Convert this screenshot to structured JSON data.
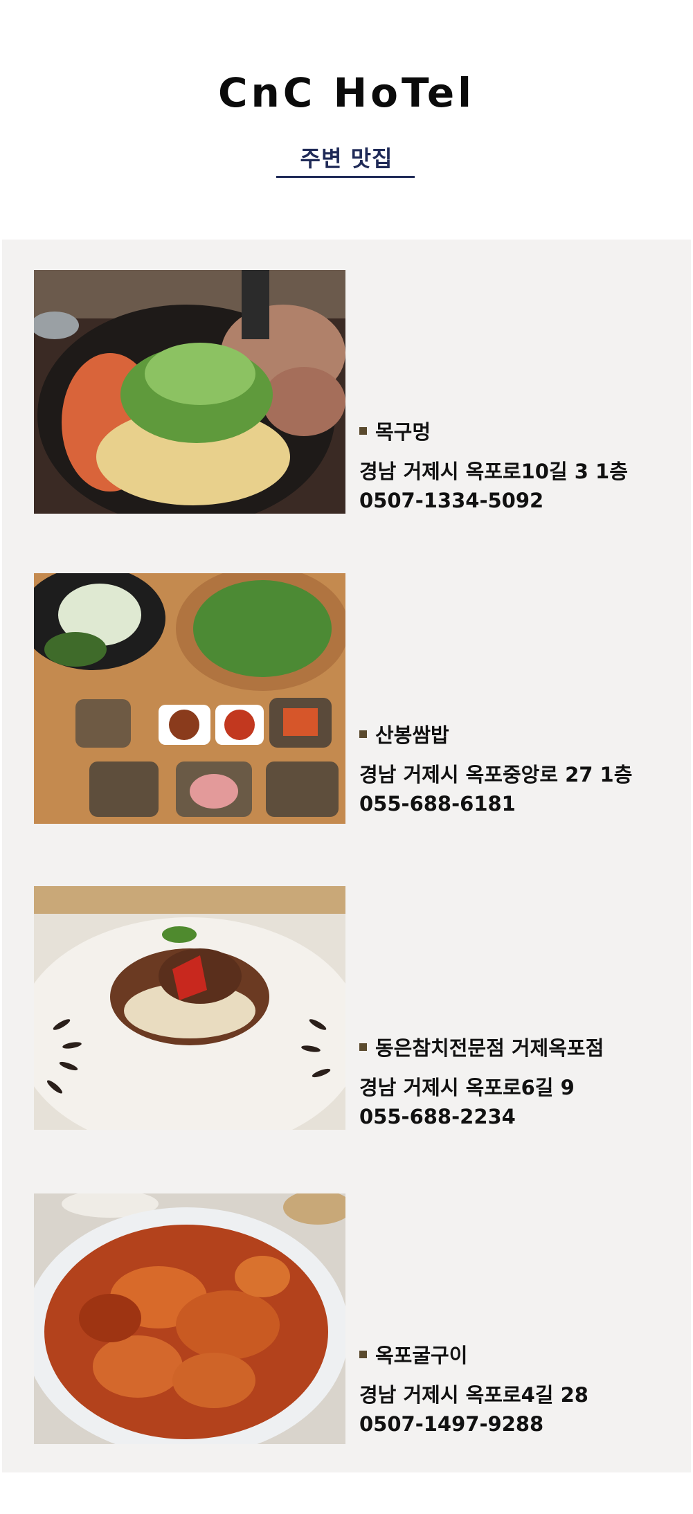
{
  "header": {
    "brand": "CnC HoTel",
    "subtitle": "주변 맛집",
    "accent_color": "#1f2a57"
  },
  "restaurants": [
    {
      "name": "목구멍",
      "address": "경남 거제시 옥포로10길 3 1층",
      "phone": "0507-1334-5092",
      "photo": "samgyeopsal-with-bean-sprouts-photo"
    },
    {
      "name": "산봉쌈밥",
      "address": "경남 거제시 옥포중앙로 27 1층",
      "phone": "055-688-6181",
      "photo": "ssambap-side-dishes-photo"
    },
    {
      "name": "동은참치전문점 거제옥포점",
      "address": "경남 거제시 옥포로6길 9",
      "phone": "055-688-2234",
      "photo": "stir-fried-dish-on-plate-photo"
    },
    {
      "name": "옥포굴구이",
      "address": "경남 거제시 옥포로4길 28",
      "phone": "0507-1497-9288",
      "photo": "spicy-oyster-dish-photo"
    }
  ],
  "colors": {
    "background": "#ffffff",
    "content_background": "#f3f2f1",
    "bullet": "#5a4a2e",
    "text": "#111111"
  }
}
